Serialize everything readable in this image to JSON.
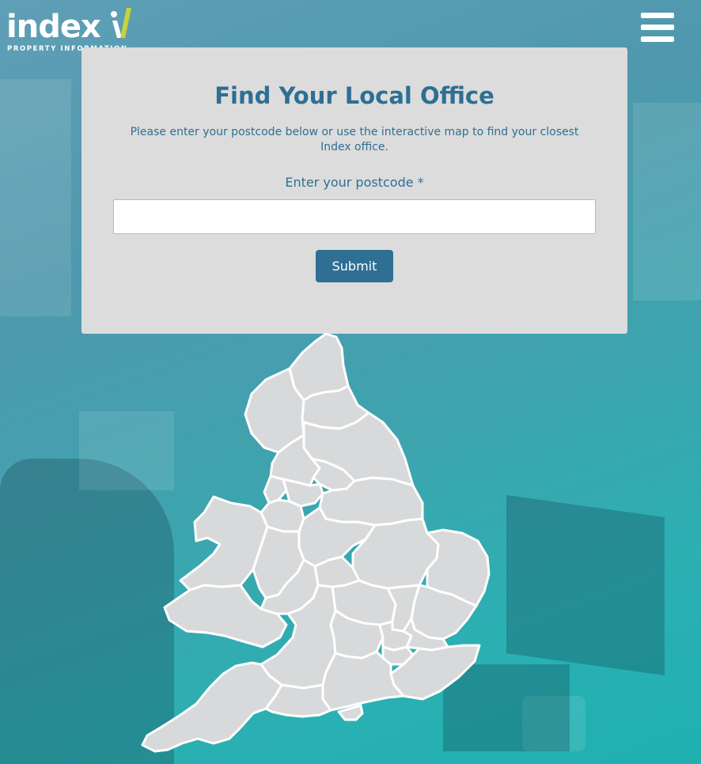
{
  "header": {
    "logo": {
      "word": "index",
      "tagline": "PROPERTY INFORMATION",
      "mark_color": "#c8d23a"
    },
    "menu_icon": "hamburger-menu-icon"
  },
  "office_finder": {
    "title": "Find Your Local Office",
    "description": "Please enter your postcode below or use the interactive map to find your closest Index office.",
    "postcode": {
      "label": "Enter your postcode *",
      "value": "",
      "placeholder": ""
    },
    "submit_label": "Submit"
  },
  "map": {
    "regions": [
      "region-1",
      "region-2",
      "region-3",
      "region-4",
      "region-5",
      "region-6",
      "region-7",
      "region-8",
      "region-9",
      "region-10",
      "region-11",
      "region-12",
      "region-13",
      "region-14",
      "region-15",
      "region-16",
      "region-17",
      "region-18",
      "region-19",
      "region-20",
      "region-21",
      "region-22",
      "region-23",
      "region-24",
      "region-25",
      "region-26",
      "region-27",
      "region-28"
    ]
  },
  "colors": {
    "accent": "#2e6f93",
    "card_background": "#dcdcdc",
    "region_fill": "#d8d9da",
    "region_border": "#ffffff",
    "background": "#3fa3ae"
  }
}
